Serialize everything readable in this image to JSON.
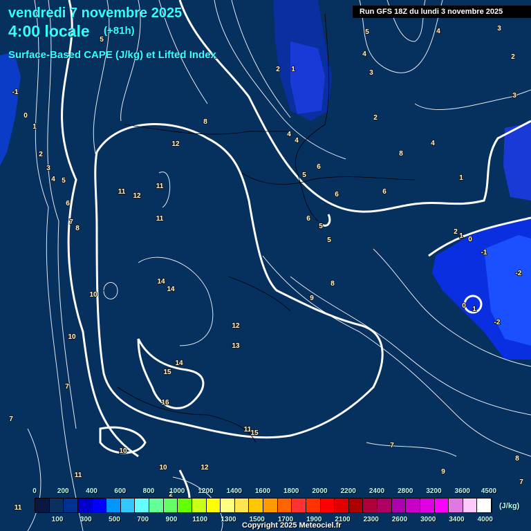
{
  "header": {
    "date": "vendredi 7 novembre 2025",
    "local_time": "4:00 locale",
    "lead_time": "(+81h)",
    "parameter": "Surface-Based CAPE (J/kg) et Lifted Index",
    "run": "Run GFS 18Z du lundi 3 novembre 2025"
  },
  "legend": {
    "unit": "(J/kg)",
    "top_labels": [
      "0",
      "200",
      "400",
      "600",
      "800",
      "1000",
      "1200",
      "1400",
      "1600",
      "1800",
      "2000",
      "2200",
      "2400",
      "2800",
      "3200",
      "3600",
      "4500"
    ],
    "bottom_labels": [
      "100",
      "300",
      "500",
      "700",
      "900",
      "1100",
      "1300",
      "1500",
      "1700",
      "1900",
      "2100",
      "2300",
      "2600",
      "3000",
      "3400",
      "4000"
    ],
    "colors": [
      "#0a1840",
      "#0a3060",
      "#003090",
      "#0000c8",
      "#0000ff",
      "#0a3cff",
      "#0096ff",
      "#32c8ff",
      "#64ffff",
      "#64ff96",
      "#64ff64",
      "#64ff00",
      "#c8ff14",
      "#ffff00",
      "#ffff80",
      "#ffe650",
      "#ffc800",
      "#ff9b00",
      "#ff6400",
      "#ff3232",
      "#ff3200",
      "#ff0000",
      "#e10000",
      "#af0000",
      "#af003c",
      "#af0064",
      "#af00af",
      "#c800c8",
      "#e100e1",
      "#ff00ff",
      "#e178e1",
      "#ffc8ff",
      "#ffffff"
    ]
  },
  "contour_labels": [
    "-1",
    "0",
    "1",
    "2",
    "3",
    "4",
    "5",
    "6",
    "7",
    "8",
    "5",
    "2",
    "1",
    "5",
    "4",
    "3",
    "4",
    "3",
    "2",
    "2",
    "3",
    "4",
    "8",
    "12",
    "11",
    "12",
    "11",
    "11",
    "14",
    "14",
    "10",
    "10",
    "7",
    "7",
    "11",
    "12",
    "13",
    "14",
    "15",
    "16",
    "11",
    "15",
    "10",
    "10",
    "11",
    "2",
    "12",
    "4",
    "5",
    "6",
    "6",
    "6",
    "5",
    "5",
    "8",
    "9",
    "6",
    "4",
    "1",
    "2",
    "1",
    "0",
    "-1",
    "-2",
    "0",
    "1",
    "-2",
    "7",
    "8",
    "9",
    "7",
    "8"
  ],
  "copyright": "Copyright 2025 Meteociel.fr"
}
